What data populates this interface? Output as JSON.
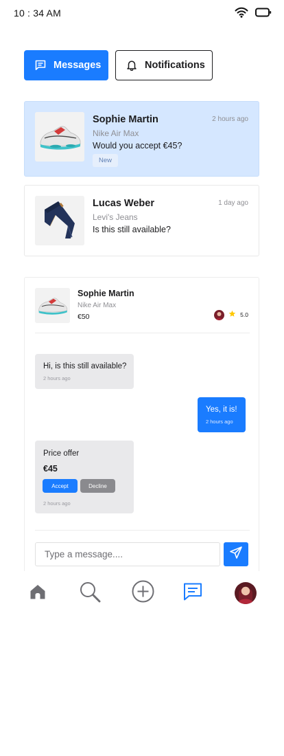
{
  "status_bar": {
    "time": "10 : 34 AM"
  },
  "tabs": [
    {
      "label": "Messages",
      "icon": "chat-icon",
      "active": true
    },
    {
      "label": "Notifications",
      "icon": "bell-icon",
      "active": false
    }
  ],
  "conversations": [
    {
      "name": "Sophie Martin",
      "time": "2 hours ago",
      "product": "Nike Air Max",
      "message": "Would you accept €45?",
      "badge": "New",
      "thumb": "sneaker-image"
    },
    {
      "name": "Lucas Weber",
      "time": "1 day ago",
      "product": "Levi's Jeans",
      "message": "Is this still available?",
      "thumb": "jeans-image"
    }
  ],
  "chat": {
    "name": "Sophie Martin",
    "product": "Nike Air Max",
    "price": "€50",
    "rating": "5.0",
    "messages": [
      {
        "text": "Hi, is this still available?",
        "time": "2 hours ago",
        "direction": "incoming"
      },
      {
        "text": "Yes, it is!",
        "time": "2 hours ago",
        "direction": "outgoing"
      }
    ],
    "offer": {
      "title": "Price offer",
      "amount": "€45",
      "accept_label": "Accept",
      "decline_label": "Decline",
      "time": "2 hours ago"
    },
    "composer_placeholder": "Type a message...."
  },
  "bottom_nav": [
    {
      "name": "home",
      "icon": "home-icon",
      "active": false
    },
    {
      "name": "search",
      "icon": "search-icon",
      "active": false
    },
    {
      "name": "add",
      "icon": "plus-circle-icon",
      "active": false
    },
    {
      "name": "messages",
      "icon": "chat-icon",
      "active": true
    },
    {
      "name": "profile",
      "icon": "avatar",
      "active": false
    }
  ],
  "colors": {
    "accent": "#1a7cff",
    "active_card": "#d5e7ff",
    "bubble_incoming": "#e9e9eb",
    "decline_button": "#8a8a8e",
    "rating_star": "#ffc800"
  }
}
